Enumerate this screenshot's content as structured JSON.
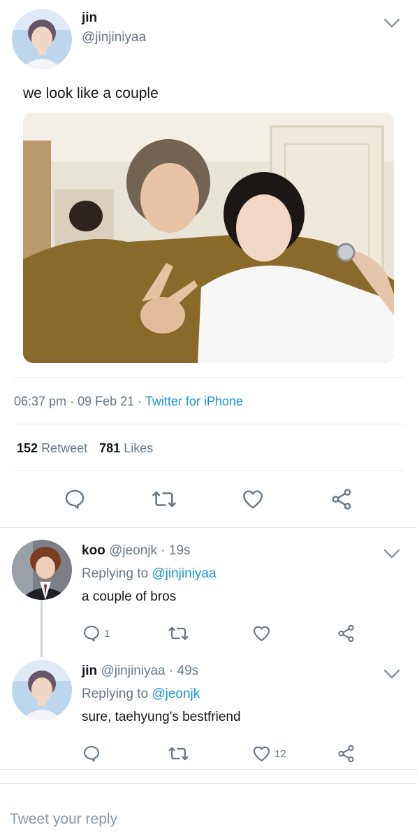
{
  "main_tweet": {
    "name": "jin",
    "handle": "@jinjiniyaa",
    "text": "we look like a couple",
    "time": "06:37 pm",
    "date": "09 Feb 21",
    "source": "Twitter for iPhone",
    "retweets_count": "152",
    "retweets_label": "Retweet",
    "likes_count": "781",
    "likes_label": "Likes"
  },
  "replies": [
    {
      "name": "koo",
      "handle": "@jeonjk",
      "time": "19s",
      "replying_label": "Replying to",
      "replying_to": "@jinjiniyaa",
      "text": "a couple of bros",
      "reply_count": "1",
      "like_count": ""
    },
    {
      "name": "jin",
      "handle": "@jinjiniyaa",
      "time": "49s",
      "replying_label": "Replying to",
      "replying_to": "@jeonjk",
      "text": "sure, taehyung's bestfriend",
      "reply_count": "",
      "like_count": "12"
    }
  ],
  "composer": {
    "placeholder": "Tweet your reply"
  },
  "colors": {
    "link": "#1b95e0",
    "muted": "#657786",
    "icon": "#657786",
    "divider": "#e1e8ed"
  },
  "icons": {
    "reply": "speech-bubble-icon",
    "retweet": "retweet-icon",
    "like": "heart-icon",
    "share": "share-icon",
    "menu": "chevron-down-icon"
  }
}
